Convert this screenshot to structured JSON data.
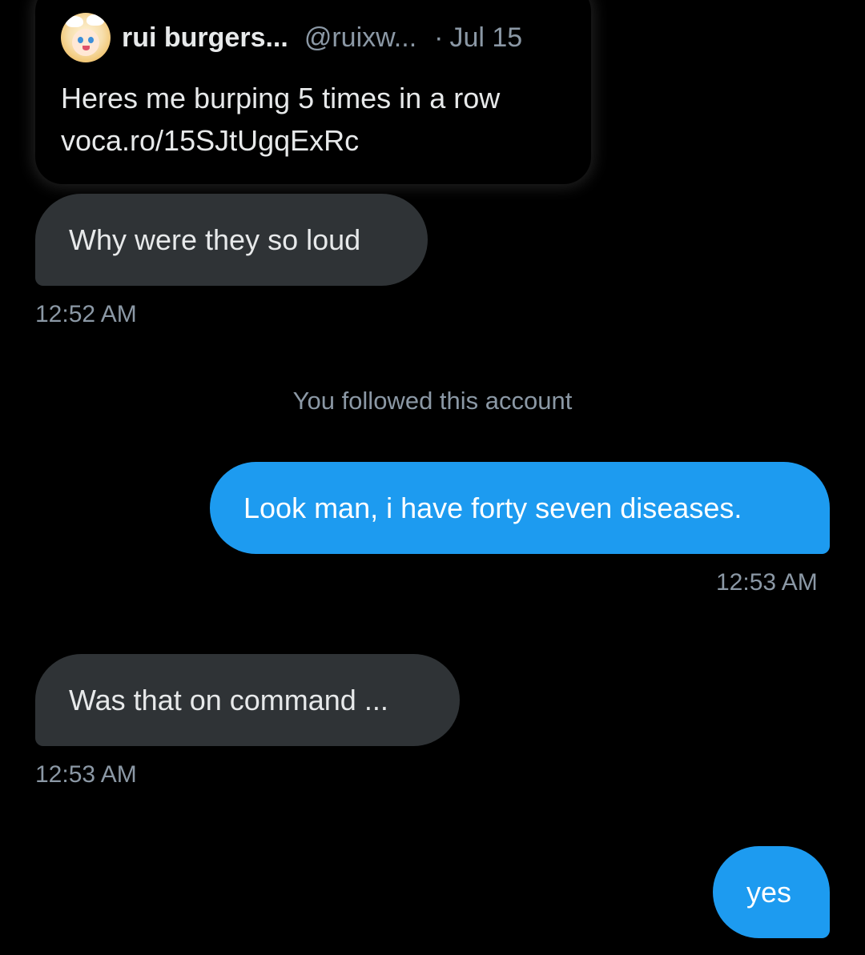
{
  "shared_tweet": {
    "author_name": "rui burgers...",
    "author_handle": "@ruixw...",
    "separator": "·",
    "date": "Jul 15",
    "text": "Heres me burping 5 times in a row",
    "link": "voca.ro/15SJtUgqExRc"
  },
  "messages": [
    {
      "direction": "in",
      "text": "Why were they so loud",
      "time": "12:52 AM"
    },
    {
      "direction": "system",
      "text": "You followed this account"
    },
    {
      "direction": "out",
      "text": "Look man, i have forty seven diseases.",
      "time": "12:53 AM"
    },
    {
      "direction": "in",
      "text": "Was that on command ...",
      "time": "12:53 AM"
    },
    {
      "direction": "out",
      "text": "yes"
    }
  ],
  "colors": {
    "background": "#000000",
    "incoming_bubble": "#2f3336",
    "outgoing_bubble": "#1d9bf0",
    "secondary_text": "#8b98a5"
  }
}
